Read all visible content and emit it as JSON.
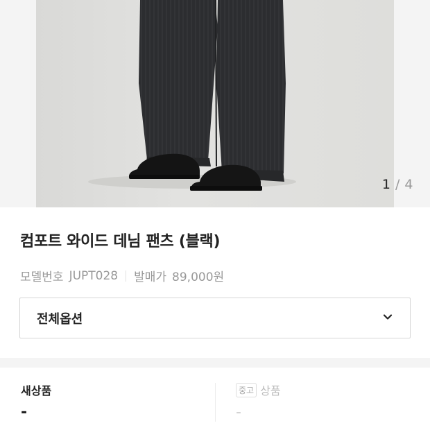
{
  "gallery": {
    "current": "1",
    "separator": "/",
    "total": "4"
  },
  "product": {
    "title": "컴포트 와이드 데님 팬츠 (블랙)",
    "model_label": "모델번호",
    "model_value": "JUPT028",
    "price_label": "발매가",
    "price_value": "89,000원"
  },
  "option_select": {
    "label": "전체옵션",
    "icon": "chevron-down-icon"
  },
  "stock": {
    "new": {
      "label": "새상품",
      "value": "-"
    },
    "used": {
      "badge": "중고",
      "label": "상품",
      "value": "-"
    }
  }
}
